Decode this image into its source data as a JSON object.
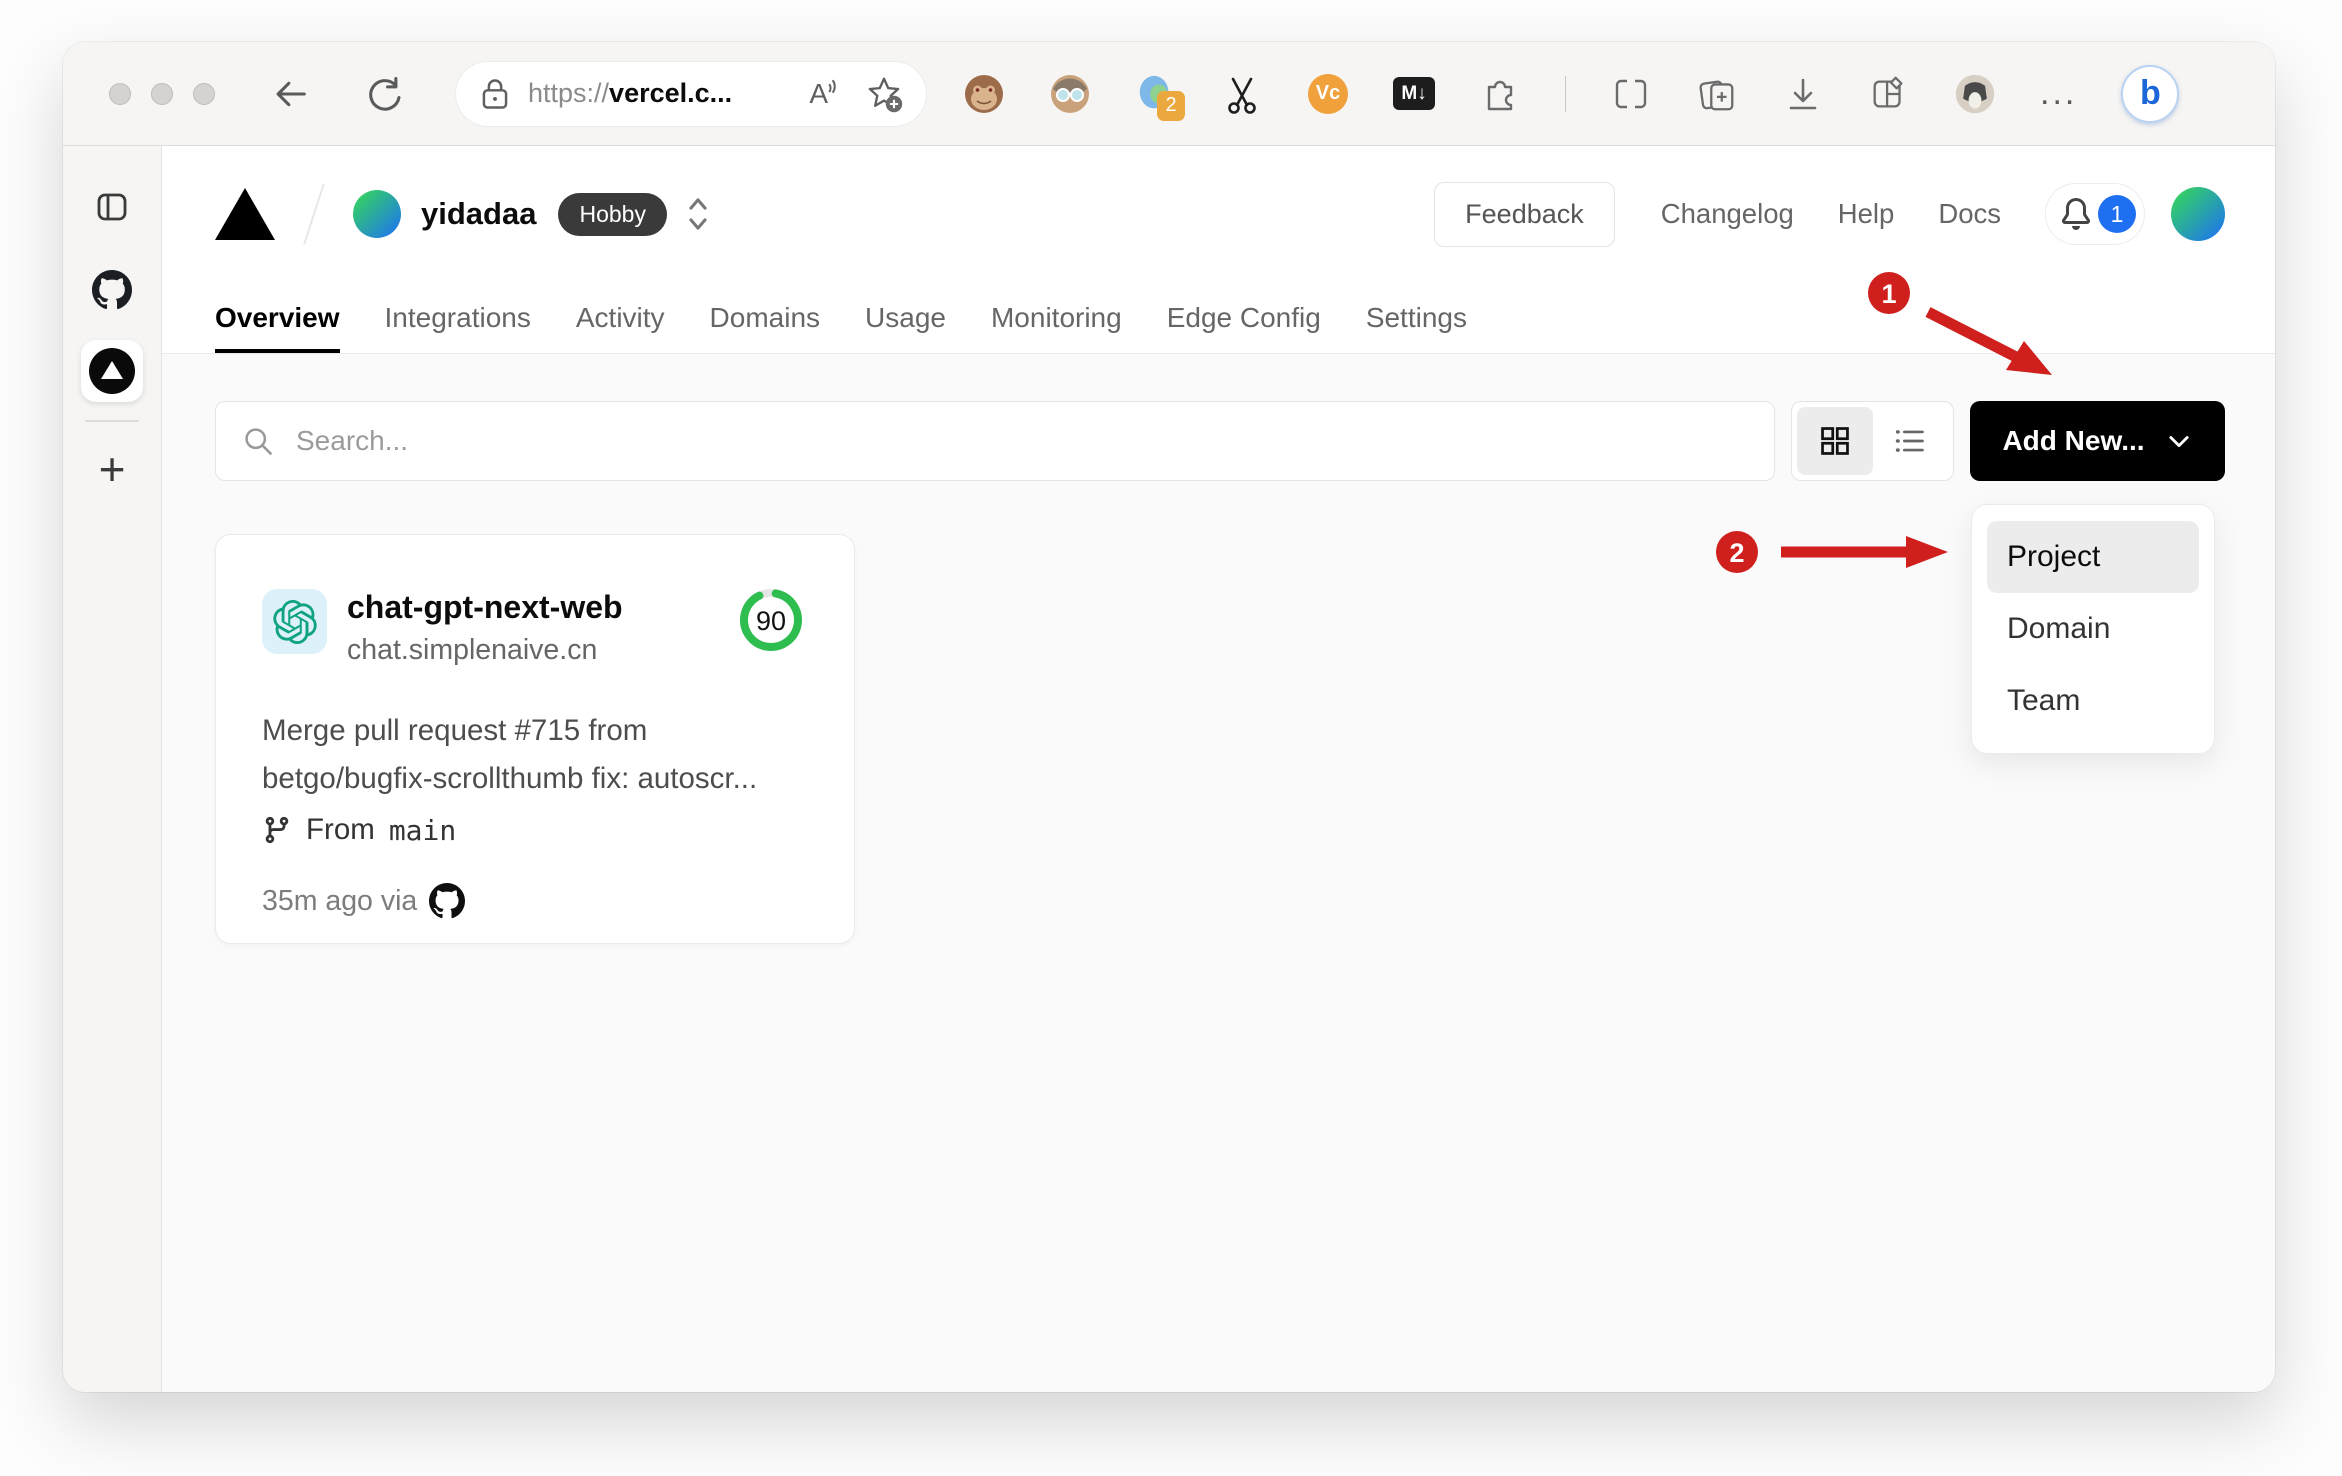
{
  "browser": {
    "url": {
      "scheme": "https://",
      "host": "vercel.c..."
    },
    "reader_label": "A",
    "extension_badge_count": "2",
    "vc_ext_label": "Vc",
    "md_ext_label": "M↓",
    "more_label": "...",
    "bing_label": "b"
  },
  "vercel": {
    "breadcrumb": {
      "team": "yidadaa",
      "plan": "Hobby"
    },
    "header_nav": {
      "feedback": "Feedback",
      "changelog": "Changelog",
      "help": "Help",
      "docs": "Docs",
      "notification_count": "1"
    },
    "tabs": [
      {
        "label": "Overview",
        "active": true
      },
      {
        "label": "Integrations"
      },
      {
        "label": "Activity"
      },
      {
        "label": "Domains"
      },
      {
        "label": "Usage"
      },
      {
        "label": "Monitoring"
      },
      {
        "label": "Edge Config"
      },
      {
        "label": "Settings"
      }
    ],
    "controls": {
      "search_placeholder": "Search...",
      "add_new": "Add New..."
    },
    "add_new_menu": [
      "Project",
      "Domain",
      "Team"
    ],
    "project": {
      "name": "chat-gpt-next-web",
      "domain": "chat.simplenaive.cn",
      "score": "90",
      "commit": "Merge pull request #715 from betgo/bugfix-scrollthumb fix: autoscr...",
      "branch_label": "From",
      "branch": "main",
      "meta": "35m ago via"
    }
  },
  "annotations": {
    "step1": "1",
    "step2": "2"
  },
  "colors": {
    "annotation_red": "#cf201d",
    "vercel_blue": "#1f6ff2",
    "score_green": "#2ebd4f",
    "openai_teal": "#10a37f",
    "badge_dark": "#3a3a3a"
  }
}
